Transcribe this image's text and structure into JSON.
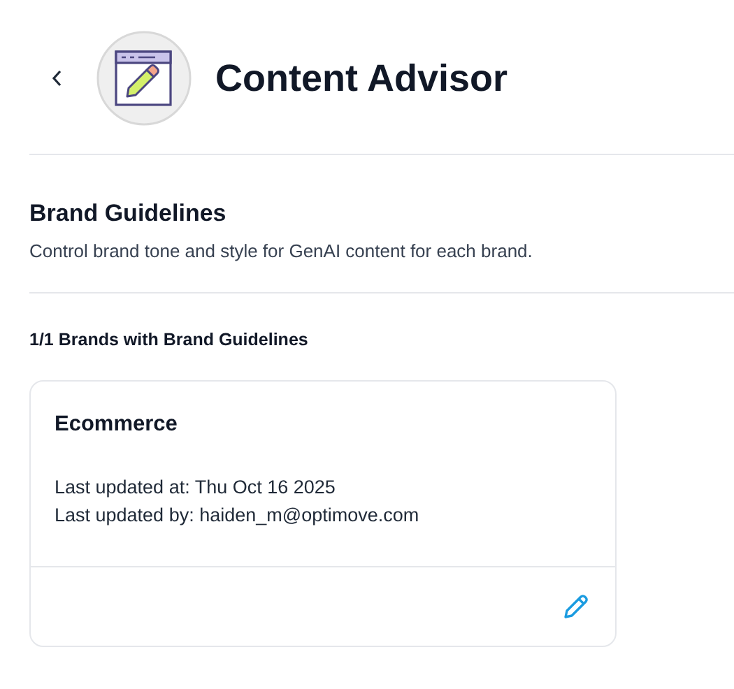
{
  "header": {
    "title": "Content Advisor"
  },
  "section": {
    "title": "Brand Guidelines",
    "description": "Control brand tone and style for GenAI content for each brand."
  },
  "count_label": "1/1 Brands with Brand Guidelines",
  "brands": [
    {
      "name": "Ecommerce",
      "details": [
        "Last updated at: Thu Oct 16 2025",
        "Last updated by: haiden_m@optimove.com"
      ]
    }
  ]
}
